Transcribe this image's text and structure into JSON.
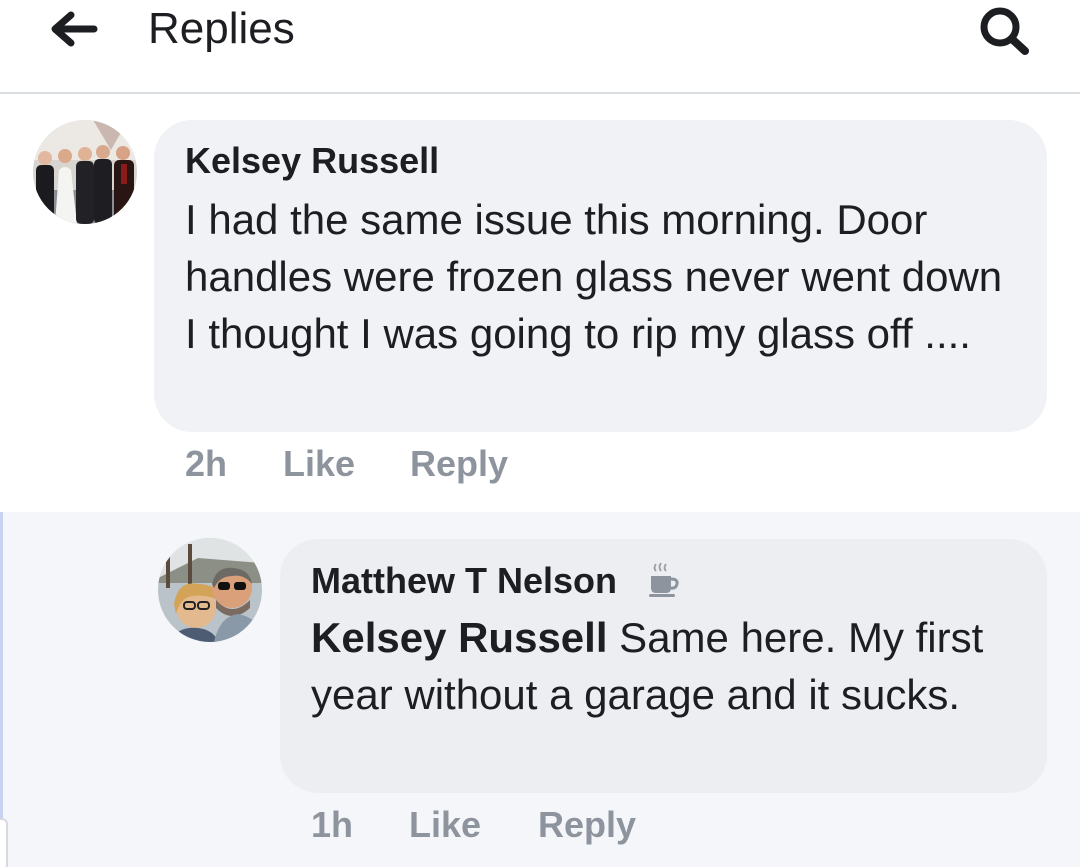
{
  "header": {
    "title": "Replies",
    "back_icon": "back-arrow-icon",
    "search_icon": "search-icon"
  },
  "comments": [
    {
      "author": "Kelsey Russell",
      "text": "I had the same issue this morning. Door handles were frozen glass never went down I thought I was going to rip my glass off ....",
      "time": "2h",
      "like_label": "Like",
      "reply_label": "Reply",
      "avatar": "wedding-group-photo"
    },
    {
      "author": "Matthew T Nelson",
      "badge_icon": "coffee-cup-icon",
      "mention": "Kelsey Russell",
      "text": " Same here.  My first year without a garage and it sucks.",
      "time": "1h",
      "like_label": "Like",
      "reply_label": "Reply",
      "avatar": "couple-selfie-photo"
    }
  ],
  "colors": {
    "bubble": "#f0f2f5",
    "meta_text": "#8d949e",
    "thread_background": "#f5f6fa"
  }
}
